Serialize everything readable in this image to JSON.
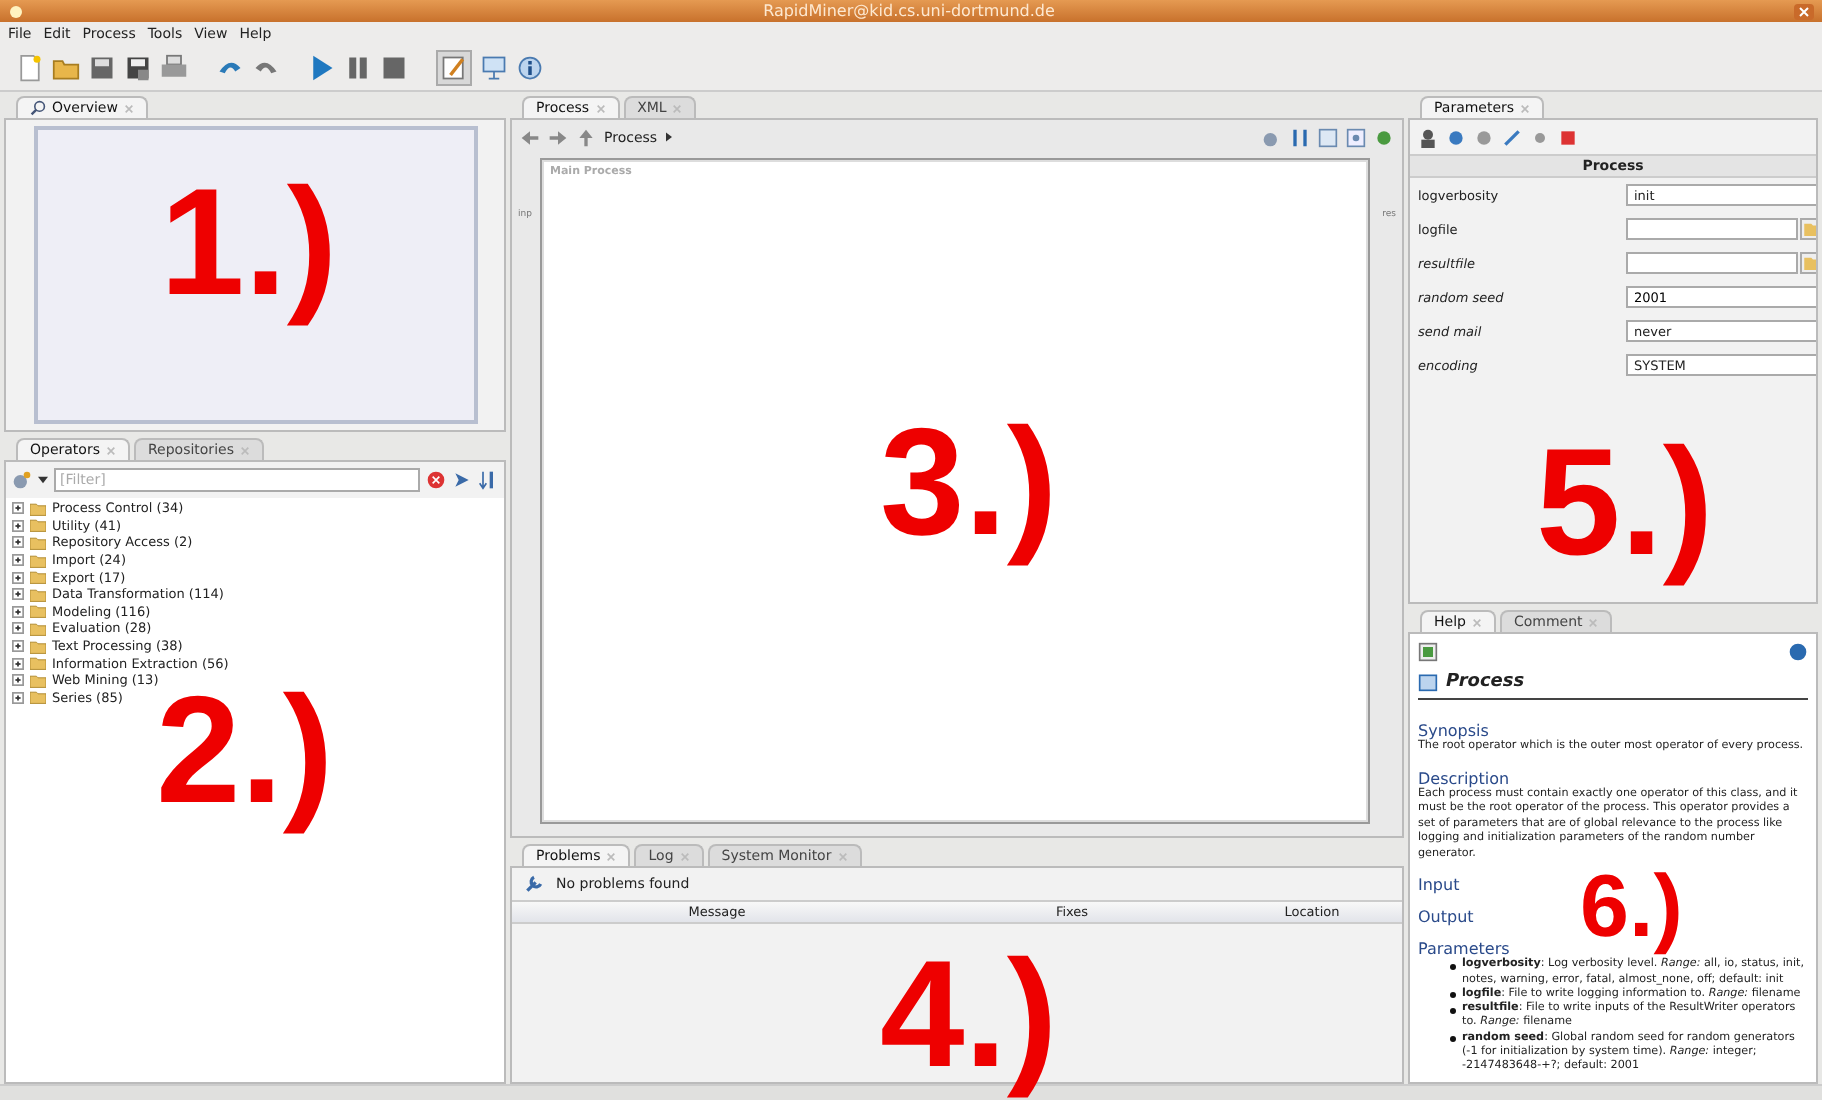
{
  "window": {
    "title": "RapidMiner@kid.cs.uni-dortmund.de"
  },
  "menu": [
    "File",
    "Edit",
    "Process",
    "Tools",
    "View",
    "Help"
  ],
  "overview": {
    "tab": "Overview"
  },
  "operators": {
    "tabs": [
      {
        "label": "Operators",
        "selected": true
      },
      {
        "label": "Repositories",
        "selected": false
      }
    ],
    "filter": {
      "placeholder": "[Filter]"
    },
    "tree": [
      {
        "label": "Process Control (34)",
        "expanded": false
      },
      {
        "label": "Utility (41)",
        "expanded": false
      },
      {
        "label": "Repository Access (2)",
        "expanded": false
      },
      {
        "label": "Import (24)",
        "expanded": false
      },
      {
        "label": "Export (17)",
        "expanded": false
      },
      {
        "label": "Data Transformation (114)",
        "expanded": false
      },
      {
        "label": "Modeling (116)",
        "expanded": false
      },
      {
        "label": "Evaluation (28)",
        "expanded": false
      },
      {
        "label": "Text Processing (38)",
        "expanded": false
      },
      {
        "label": "Information Extraction (56)",
        "expanded": false
      },
      {
        "label": "Web Mining (13)",
        "expanded": false
      },
      {
        "label": "Series (85)",
        "expanded": false
      }
    ]
  },
  "process": {
    "tabs": [
      {
        "label": "Process",
        "selected": true
      },
      {
        "label": "XML",
        "selected": false
      }
    ],
    "breadcrumb": "Process",
    "canvas_title": "Main Process",
    "port_in": "inp",
    "port_out": "res"
  },
  "bottom": {
    "tabs": [
      {
        "label": "Problems",
        "selected": true
      },
      {
        "label": "Log",
        "selected": false
      },
      {
        "label": "System Monitor",
        "selected": false
      }
    ],
    "status": "No problems found",
    "columns": [
      "Message",
      "Fixes",
      "Location"
    ]
  },
  "parameters": {
    "tab": "Parameters",
    "operator": "Process",
    "rows": [
      {
        "name": "logverbosity",
        "kind": "combo",
        "expert": false,
        "value": "init"
      },
      {
        "name": "logfile",
        "kind": "file",
        "expert": false
      },
      {
        "name": "resultfile",
        "kind": "file",
        "expert": true
      },
      {
        "name": "random seed",
        "kind": "text",
        "expert": true,
        "value": "2001"
      },
      {
        "name": "send mail",
        "kind": "combo",
        "expert": true,
        "value": "never"
      },
      {
        "name": "encoding",
        "kind": "combo",
        "expert": true,
        "value": "SYSTEM"
      }
    ]
  },
  "help": {
    "tabs": [
      {
        "label": "Help",
        "selected": true
      },
      {
        "label": "Comment",
        "selected": false
      }
    ],
    "title": "Process",
    "sections": [
      {
        "heading": "Synopsis",
        "text": "The root operator which is the outer most operator of every process."
      },
      {
        "heading": "Description",
        "text": "Each process must contain exactly one operator of this class, and it must be the root operator of the process. This operator provides a set of parameters that are of global relevance to the process like logging and initialization parameters of the random number generator."
      },
      {
        "heading": "Input"
      },
      {
        "heading": "Output"
      },
      {
        "heading": "Parameters",
        "items": [
          "**logverbosity**: Log verbosity level. *Range:* all, io, status, init, notes, warning, error, fatal, almost_none, off; default: init",
          "**logfile**: File to write logging information to. *Range:* filename",
          "**resultfile**: File to write inputs of the ResultWriter operators to. *Range:* filename",
          "**random seed**: Global random seed for random generators (-1 for initialization by system time). *Range:* integer; -2147483648-+?; default: 2001"
        ]
      }
    ]
  },
  "annotations": [
    "1.)",
    "2.)",
    "3.)",
    "4.)",
    "5.)",
    "6.)"
  ]
}
